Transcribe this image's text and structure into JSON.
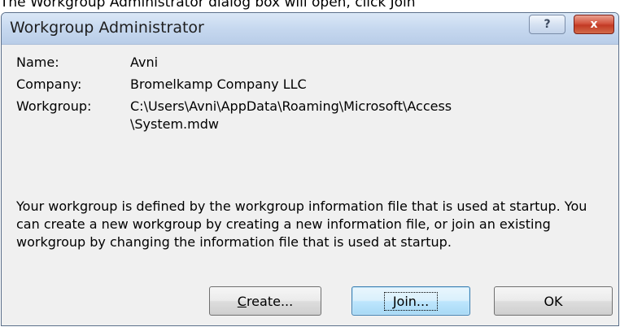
{
  "page_caption": "The Workgroup Administrator dialog box will open, click Join",
  "dialog": {
    "title": "Workgroup Administrator",
    "help_glyph": "?",
    "close_glyph": "x"
  },
  "info": [
    {
      "label": "Name:",
      "value": "Avni"
    },
    {
      "label": "Company:",
      "value": "Bromelkamp Company LLC"
    },
    {
      "label": "Workgroup:",
      "value": "C:\\Users\\Avni\\AppData\\Roaming\\Microsoft\\Access\n\\System.mdw"
    }
  ],
  "description": "Your workgroup is defined by the workgroup information file that is used at startup. You can create a new workgroup by creating a new information file, or join an existing workgroup by changing the information file that is used at startup.",
  "buttons": {
    "create": {
      "mnemonic": "C",
      "rest": "reate..."
    },
    "join": {
      "mnemonic": "J",
      "rest": "oin..."
    },
    "ok": {
      "label": "OK"
    }
  }
}
